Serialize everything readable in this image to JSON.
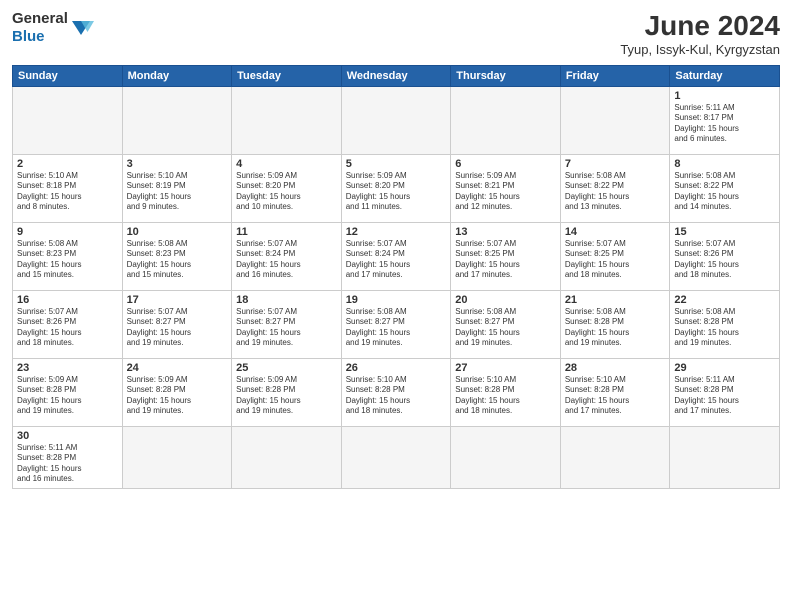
{
  "header": {
    "logo_general": "General",
    "logo_blue": "Blue",
    "title": "June 2024",
    "subtitle": "Tyup, Issyk-Kul, Kyrgyzstan"
  },
  "weekdays": [
    "Sunday",
    "Monday",
    "Tuesday",
    "Wednesday",
    "Thursday",
    "Friday",
    "Saturday"
  ],
  "weeks": [
    [
      {
        "day": "",
        "info": ""
      },
      {
        "day": "",
        "info": ""
      },
      {
        "day": "",
        "info": ""
      },
      {
        "day": "",
        "info": ""
      },
      {
        "day": "",
        "info": ""
      },
      {
        "day": "",
        "info": ""
      },
      {
        "day": "1",
        "info": "Sunrise: 5:11 AM\nSunset: 8:17 PM\nDaylight: 15 hours\nand 6 minutes."
      }
    ],
    [
      {
        "day": "2",
        "info": "Sunrise: 5:10 AM\nSunset: 8:18 PM\nDaylight: 15 hours\nand 8 minutes."
      },
      {
        "day": "3",
        "info": "Sunrise: 5:10 AM\nSunset: 8:19 PM\nDaylight: 15 hours\nand 9 minutes."
      },
      {
        "day": "4",
        "info": "Sunrise: 5:09 AM\nSunset: 8:20 PM\nDaylight: 15 hours\nand 10 minutes."
      },
      {
        "day": "5",
        "info": "Sunrise: 5:09 AM\nSunset: 8:20 PM\nDaylight: 15 hours\nand 11 minutes."
      },
      {
        "day": "6",
        "info": "Sunrise: 5:09 AM\nSunset: 8:21 PM\nDaylight: 15 hours\nand 12 minutes."
      },
      {
        "day": "7",
        "info": "Sunrise: 5:08 AM\nSunset: 8:22 PM\nDaylight: 15 hours\nand 13 minutes."
      },
      {
        "day": "8",
        "info": "Sunrise: 5:08 AM\nSunset: 8:22 PM\nDaylight: 15 hours\nand 14 minutes."
      }
    ],
    [
      {
        "day": "9",
        "info": "Sunrise: 5:08 AM\nSunset: 8:23 PM\nDaylight: 15 hours\nand 15 minutes."
      },
      {
        "day": "10",
        "info": "Sunrise: 5:08 AM\nSunset: 8:23 PM\nDaylight: 15 hours\nand 15 minutes."
      },
      {
        "day": "11",
        "info": "Sunrise: 5:07 AM\nSunset: 8:24 PM\nDaylight: 15 hours\nand 16 minutes."
      },
      {
        "day": "12",
        "info": "Sunrise: 5:07 AM\nSunset: 8:24 PM\nDaylight: 15 hours\nand 17 minutes."
      },
      {
        "day": "13",
        "info": "Sunrise: 5:07 AM\nSunset: 8:25 PM\nDaylight: 15 hours\nand 17 minutes."
      },
      {
        "day": "14",
        "info": "Sunrise: 5:07 AM\nSunset: 8:25 PM\nDaylight: 15 hours\nand 18 minutes."
      },
      {
        "day": "15",
        "info": "Sunrise: 5:07 AM\nSunset: 8:26 PM\nDaylight: 15 hours\nand 18 minutes."
      }
    ],
    [
      {
        "day": "16",
        "info": "Sunrise: 5:07 AM\nSunset: 8:26 PM\nDaylight: 15 hours\nand 18 minutes."
      },
      {
        "day": "17",
        "info": "Sunrise: 5:07 AM\nSunset: 8:27 PM\nDaylight: 15 hours\nand 19 minutes."
      },
      {
        "day": "18",
        "info": "Sunrise: 5:07 AM\nSunset: 8:27 PM\nDaylight: 15 hours\nand 19 minutes."
      },
      {
        "day": "19",
        "info": "Sunrise: 5:08 AM\nSunset: 8:27 PM\nDaylight: 15 hours\nand 19 minutes."
      },
      {
        "day": "20",
        "info": "Sunrise: 5:08 AM\nSunset: 8:27 PM\nDaylight: 15 hours\nand 19 minutes."
      },
      {
        "day": "21",
        "info": "Sunrise: 5:08 AM\nSunset: 8:28 PM\nDaylight: 15 hours\nand 19 minutes."
      },
      {
        "day": "22",
        "info": "Sunrise: 5:08 AM\nSunset: 8:28 PM\nDaylight: 15 hours\nand 19 minutes."
      }
    ],
    [
      {
        "day": "23",
        "info": "Sunrise: 5:09 AM\nSunset: 8:28 PM\nDaylight: 15 hours\nand 19 minutes."
      },
      {
        "day": "24",
        "info": "Sunrise: 5:09 AM\nSunset: 8:28 PM\nDaylight: 15 hours\nand 19 minutes."
      },
      {
        "day": "25",
        "info": "Sunrise: 5:09 AM\nSunset: 8:28 PM\nDaylight: 15 hours\nand 19 minutes."
      },
      {
        "day": "26",
        "info": "Sunrise: 5:10 AM\nSunset: 8:28 PM\nDaylight: 15 hours\nand 18 minutes."
      },
      {
        "day": "27",
        "info": "Sunrise: 5:10 AM\nSunset: 8:28 PM\nDaylight: 15 hours\nand 18 minutes."
      },
      {
        "day": "28",
        "info": "Sunrise: 5:10 AM\nSunset: 8:28 PM\nDaylight: 15 hours\nand 17 minutes."
      },
      {
        "day": "29",
        "info": "Sunrise: 5:11 AM\nSunset: 8:28 PM\nDaylight: 15 hours\nand 17 minutes."
      }
    ],
    [
      {
        "day": "30",
        "info": "Sunrise: 5:11 AM\nSunset: 8:28 PM\nDaylight: 15 hours\nand 16 minutes."
      },
      {
        "day": "",
        "info": ""
      },
      {
        "day": "",
        "info": ""
      },
      {
        "day": "",
        "info": ""
      },
      {
        "day": "",
        "info": ""
      },
      {
        "day": "",
        "info": ""
      },
      {
        "day": "",
        "info": ""
      }
    ]
  ]
}
